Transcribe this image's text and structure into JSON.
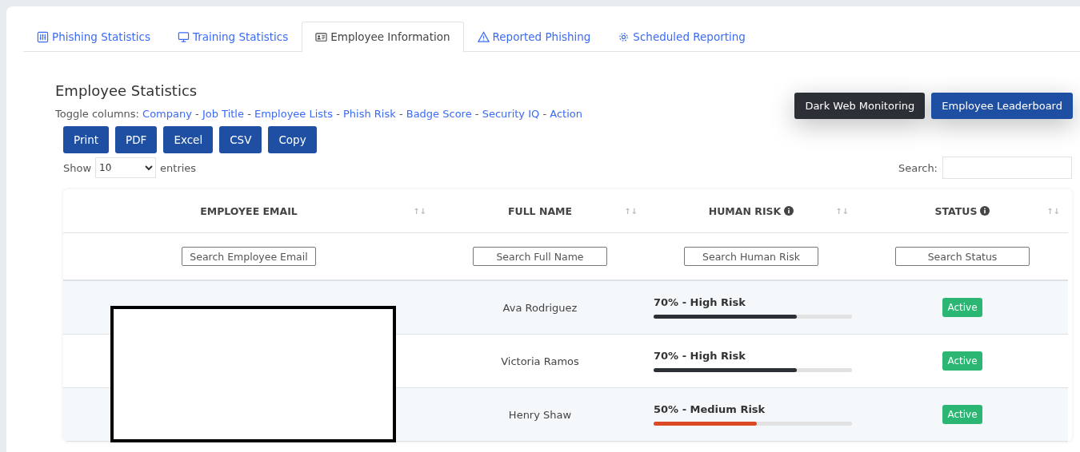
{
  "tabs": [
    {
      "label": "Phishing Statistics",
      "selected": false
    },
    {
      "label": "Training Statistics",
      "selected": false
    },
    {
      "label": "Employee Information",
      "selected": true
    },
    {
      "label": "Reported Phishing",
      "selected": false
    },
    {
      "label": "Scheduled Reporting",
      "selected": false
    }
  ],
  "title": "Employee Statistics",
  "toggle_label": "Toggle columns:",
  "toggle_columns": [
    "Company",
    "Job Title",
    "Employee Lists",
    "Phish Risk",
    "Badge Score",
    "Security IQ",
    "Action"
  ],
  "toggle_separator": "-",
  "export_buttons": [
    "Print",
    "PDF",
    "Excel",
    "CSV",
    "Copy"
  ],
  "top_buttons": [
    {
      "label": "Dark Web Monitoring",
      "kind": "dark"
    },
    {
      "label": "Employee Leaderboard",
      "kind": "primary"
    }
  ],
  "length": {
    "before": "Show",
    "value": "10",
    "after": "entries"
  },
  "search": {
    "label": "Search:"
  },
  "sort_icon": "↑↓",
  "columns": [
    {
      "label": "EMPLOYEE EMAIL",
      "info": false,
      "placeholder": "Search Employee Email"
    },
    {
      "label": "FULL NAME",
      "info": false,
      "placeholder": "Search Full Name"
    },
    {
      "label": "HUMAN RISK",
      "info": true,
      "placeholder": "Search Human Risk"
    },
    {
      "label": "STATUS",
      "info": true,
      "placeholder": "Search Status"
    }
  ],
  "rows": [
    {
      "name": "Ava Rodriguez",
      "risk": "70% - High Risk",
      "level": 0.72,
      "color": "#2c3036",
      "status": "Active"
    },
    {
      "name": "Victoria Ramos",
      "risk": "70% - High Risk",
      "level": 0.72,
      "color": "#2c3036",
      "status": "Active"
    },
    {
      "name": "Henry Shaw",
      "risk": "50% - Medium Risk",
      "level": 0.52,
      "color": "#dc4a24",
      "status": "Active"
    }
  ]
}
